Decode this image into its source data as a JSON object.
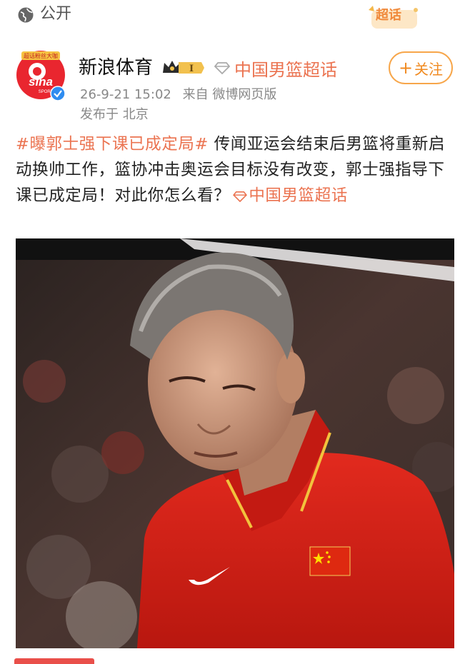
{
  "header": {
    "visibility_label": "公开",
    "badge_label": "超话",
    "visibility_icon": "globe-icon"
  },
  "post": {
    "author": {
      "name": "新浪体育",
      "level_badge": "I",
      "avatar_brand_text": "sina",
      "avatar_banner_text": "超话粉丝大咖",
      "avatar_sub_text": "SPORTS",
      "verified_icon": "verified-check-icon"
    },
    "topic": {
      "label": "中国男篮超话",
      "icon": "diamond-topic-icon"
    },
    "meta": {
      "timestamp": "26-9-21 15:02",
      "source": "来自 微博网页版",
      "location": "发布于 北京"
    },
    "follow_button": {
      "plus": "+",
      "label": "关注"
    },
    "body": {
      "hashtag": "#曝郭士强下课已成定局#",
      "text": " 传闻亚运会结束后男篮将重新启动换帅工作，篮协冲击奥运会目标没有改变，郭士强指导下课已成定局！对此你怎么看？",
      "topic_link": "中国男篮超话"
    },
    "image": {
      "description_icon": "photo-coach-red-jersey"
    }
  },
  "colors": {
    "accent_orange": "#eb7350",
    "follow_orange": "#f7a64a",
    "meta_gray": "#888888",
    "jersey_red": "#d8231c"
  }
}
